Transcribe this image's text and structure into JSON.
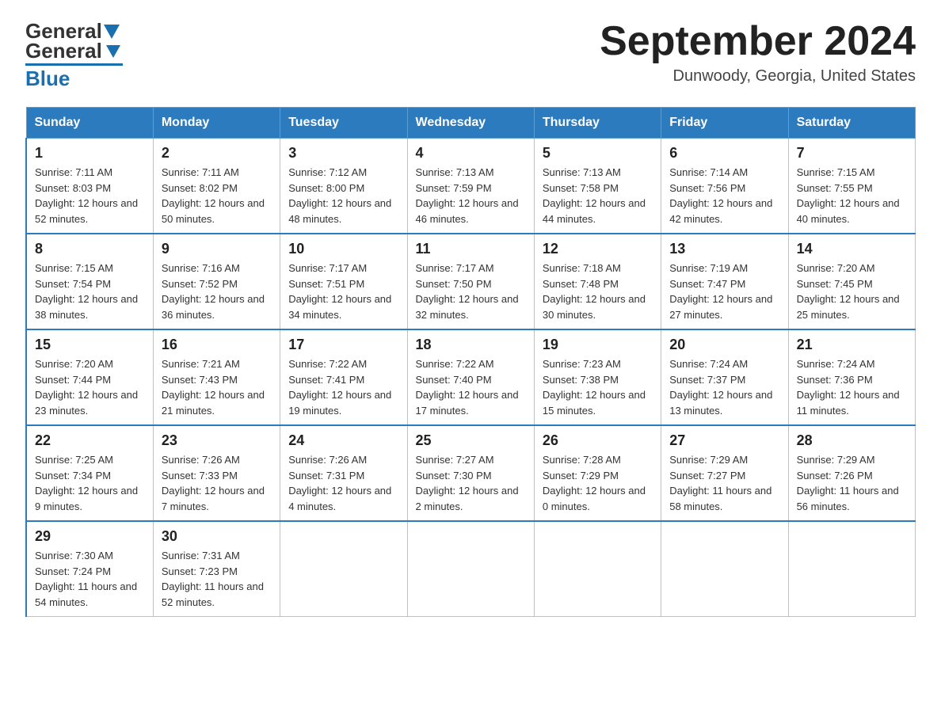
{
  "header": {
    "logo_general": "General",
    "logo_blue": "Blue",
    "month_title": "September 2024",
    "location": "Dunwoody, Georgia, United States"
  },
  "weekdays": [
    "Sunday",
    "Monday",
    "Tuesday",
    "Wednesday",
    "Thursday",
    "Friday",
    "Saturday"
  ],
  "weeks": [
    [
      {
        "day": "1",
        "sunrise": "7:11 AM",
        "sunset": "8:03 PM",
        "daylight": "12 hours and 52 minutes."
      },
      {
        "day": "2",
        "sunrise": "7:11 AM",
        "sunset": "8:02 PM",
        "daylight": "12 hours and 50 minutes."
      },
      {
        "day": "3",
        "sunrise": "7:12 AM",
        "sunset": "8:00 PM",
        "daylight": "12 hours and 48 minutes."
      },
      {
        "day": "4",
        "sunrise": "7:13 AM",
        "sunset": "7:59 PM",
        "daylight": "12 hours and 46 minutes."
      },
      {
        "day": "5",
        "sunrise": "7:13 AM",
        "sunset": "7:58 PM",
        "daylight": "12 hours and 44 minutes."
      },
      {
        "day": "6",
        "sunrise": "7:14 AM",
        "sunset": "7:56 PM",
        "daylight": "12 hours and 42 minutes."
      },
      {
        "day": "7",
        "sunrise": "7:15 AM",
        "sunset": "7:55 PM",
        "daylight": "12 hours and 40 minutes."
      }
    ],
    [
      {
        "day": "8",
        "sunrise": "7:15 AM",
        "sunset": "7:54 PM",
        "daylight": "12 hours and 38 minutes."
      },
      {
        "day": "9",
        "sunrise": "7:16 AM",
        "sunset": "7:52 PM",
        "daylight": "12 hours and 36 minutes."
      },
      {
        "day": "10",
        "sunrise": "7:17 AM",
        "sunset": "7:51 PM",
        "daylight": "12 hours and 34 minutes."
      },
      {
        "day": "11",
        "sunrise": "7:17 AM",
        "sunset": "7:50 PM",
        "daylight": "12 hours and 32 minutes."
      },
      {
        "day": "12",
        "sunrise": "7:18 AM",
        "sunset": "7:48 PM",
        "daylight": "12 hours and 30 minutes."
      },
      {
        "day": "13",
        "sunrise": "7:19 AM",
        "sunset": "7:47 PM",
        "daylight": "12 hours and 27 minutes."
      },
      {
        "day": "14",
        "sunrise": "7:20 AM",
        "sunset": "7:45 PM",
        "daylight": "12 hours and 25 minutes."
      }
    ],
    [
      {
        "day": "15",
        "sunrise": "7:20 AM",
        "sunset": "7:44 PM",
        "daylight": "12 hours and 23 minutes."
      },
      {
        "day": "16",
        "sunrise": "7:21 AM",
        "sunset": "7:43 PM",
        "daylight": "12 hours and 21 minutes."
      },
      {
        "day": "17",
        "sunrise": "7:22 AM",
        "sunset": "7:41 PM",
        "daylight": "12 hours and 19 minutes."
      },
      {
        "day": "18",
        "sunrise": "7:22 AM",
        "sunset": "7:40 PM",
        "daylight": "12 hours and 17 minutes."
      },
      {
        "day": "19",
        "sunrise": "7:23 AM",
        "sunset": "7:38 PM",
        "daylight": "12 hours and 15 minutes."
      },
      {
        "day": "20",
        "sunrise": "7:24 AM",
        "sunset": "7:37 PM",
        "daylight": "12 hours and 13 minutes."
      },
      {
        "day": "21",
        "sunrise": "7:24 AM",
        "sunset": "7:36 PM",
        "daylight": "12 hours and 11 minutes."
      }
    ],
    [
      {
        "day": "22",
        "sunrise": "7:25 AM",
        "sunset": "7:34 PM",
        "daylight": "12 hours and 9 minutes."
      },
      {
        "day": "23",
        "sunrise": "7:26 AM",
        "sunset": "7:33 PM",
        "daylight": "12 hours and 7 minutes."
      },
      {
        "day": "24",
        "sunrise": "7:26 AM",
        "sunset": "7:31 PM",
        "daylight": "12 hours and 4 minutes."
      },
      {
        "day": "25",
        "sunrise": "7:27 AM",
        "sunset": "7:30 PM",
        "daylight": "12 hours and 2 minutes."
      },
      {
        "day": "26",
        "sunrise": "7:28 AM",
        "sunset": "7:29 PM",
        "daylight": "12 hours and 0 minutes."
      },
      {
        "day": "27",
        "sunrise": "7:29 AM",
        "sunset": "7:27 PM",
        "daylight": "11 hours and 58 minutes."
      },
      {
        "day": "28",
        "sunrise": "7:29 AM",
        "sunset": "7:26 PM",
        "daylight": "11 hours and 56 minutes."
      }
    ],
    [
      {
        "day": "29",
        "sunrise": "7:30 AM",
        "sunset": "7:24 PM",
        "daylight": "11 hours and 54 minutes."
      },
      {
        "day": "30",
        "sunrise": "7:31 AM",
        "sunset": "7:23 PM",
        "daylight": "11 hours and 52 minutes."
      },
      null,
      null,
      null,
      null,
      null
    ]
  ],
  "labels": {
    "sunrise_prefix": "Sunrise: ",
    "sunset_prefix": "Sunset: ",
    "daylight_prefix": "Daylight: "
  }
}
